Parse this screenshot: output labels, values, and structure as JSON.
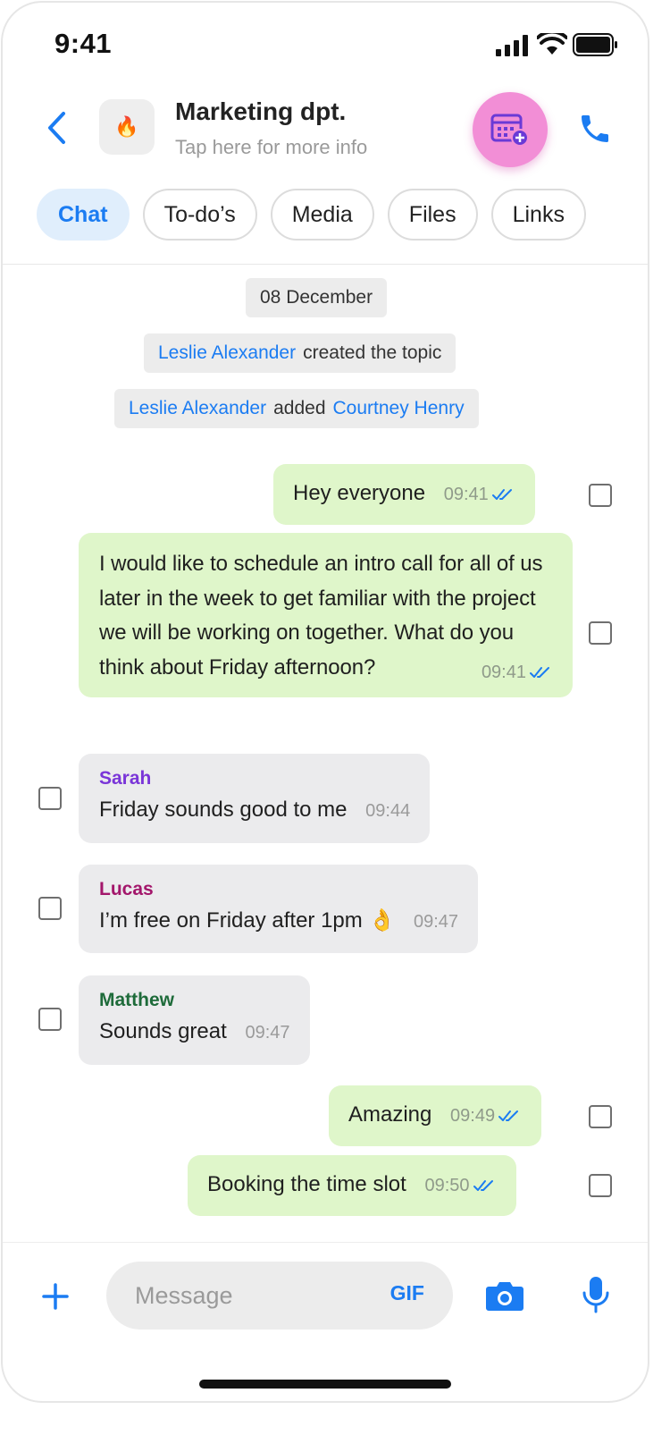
{
  "status_bar": {
    "time": "9:41"
  },
  "header": {
    "group_emoji": "🔥",
    "title": "Marketing dpt.",
    "subtitle": "Tap here for more info"
  },
  "tabs": [
    {
      "label": "Chat",
      "active": true
    },
    {
      "label": "To-do’s",
      "active": false
    },
    {
      "label": "Media",
      "active": false
    },
    {
      "label": "Files",
      "active": false
    },
    {
      "label": "Links",
      "active": false
    }
  ],
  "notices": {
    "date": "08 December",
    "created": {
      "user": "Leslie Alexander",
      "text": "created the topic"
    },
    "added": {
      "user": "Leslie Alexander",
      "text": "added",
      "target": "Courtney Henry"
    }
  },
  "messages": [
    {
      "mine": true,
      "text": "Hey everyone",
      "time": "09:41"
    },
    {
      "mine": true,
      "text": "I would like to schedule an intro call for all of us later in the week to get familiar with the project we will be working on together. What do you think about Friday afternoon?",
      "time": "09:41"
    },
    {
      "mine": false,
      "sender": "Sarah",
      "text": "Friday sounds good to me",
      "time": "09:44"
    },
    {
      "mine": false,
      "sender": "Lucas",
      "text": "I’m free on Friday after 1pm 👌",
      "time": "09:47"
    },
    {
      "mine": false,
      "sender": "Matthew",
      "text": "Sounds great",
      "time": "09:47"
    },
    {
      "mine": true,
      "text": "Amazing",
      "time": "09:49"
    },
    {
      "mine": true,
      "text": "Booking the time slot",
      "time": "09:50"
    }
  ],
  "composer": {
    "placeholder": "Message",
    "gif_label": "GIF"
  },
  "colors": {
    "accent": "#1b7cf2",
    "my_bubble": "#dff6ca",
    "their_bubble": "#ebebed",
    "schedule_button": "#f28ed6",
    "sarah": "#7a35d8",
    "lucas": "#a3166b",
    "matthew": "#1e6b3a"
  },
  "icons": {
    "back": "chevron-left-icon",
    "schedule": "calendar-add-icon",
    "call": "phone-icon",
    "read_receipt": "double-check-icon",
    "add": "plus-icon",
    "camera": "camera-icon",
    "mic": "microphone-icon"
  }
}
